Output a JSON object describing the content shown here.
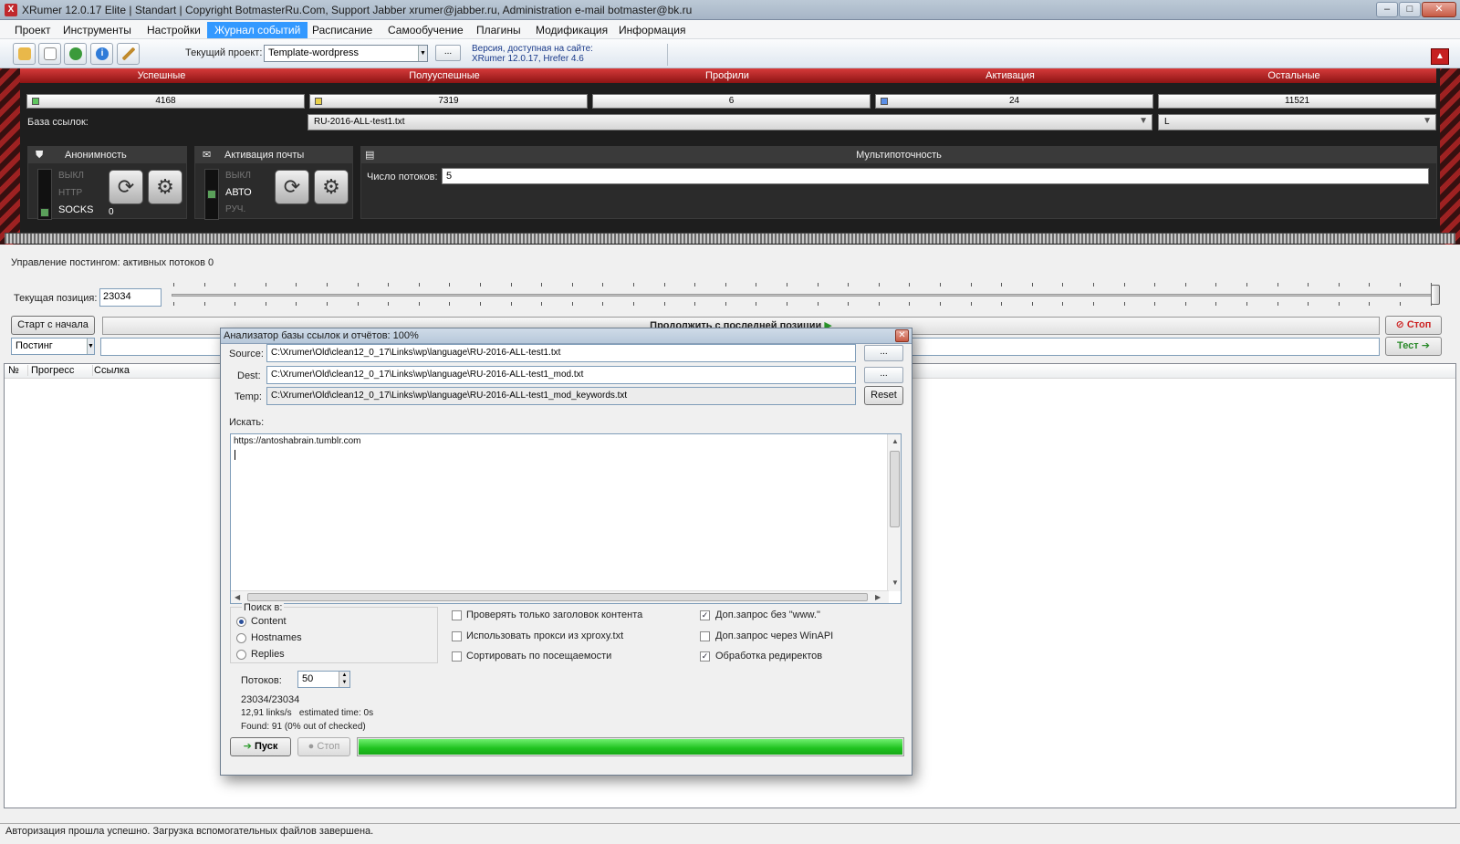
{
  "window": {
    "title": "XRumer 12.0.17 Elite | Standart | Copyright BotmasterRu.Com, Support Jabber xrumer@jabber.ru, Administration e-mail botmaster@bk.ru",
    "minimize": "–",
    "maximize": "□",
    "close": "✕"
  },
  "menu": [
    "Проект",
    "Инструменты",
    "Настройки",
    "Журнал событий",
    "Расписание",
    "Самообучение",
    "Плагины",
    "Модификация",
    "Информация"
  ],
  "menu_active": "Журнал событий",
  "toolbar": {
    "icons": [
      "open-folder-icon",
      "edit-icon",
      "refresh-icon",
      "info-icon",
      "wand-icon"
    ],
    "current_project_label": "Текущий проект:",
    "current_project_value": "Template-wordpress",
    "browse_label": "...",
    "version_line1": "Версия, доступная на сайте:",
    "version_line2": "XRumer 12.0.17, Hrefer 4.6"
  },
  "stats": {
    "headers": [
      "Успешные",
      "Полууспешные",
      "Профили",
      "Активация",
      "Остальные"
    ],
    "values": [
      "4168",
      "7319",
      "6",
      "24",
      "11521"
    ]
  },
  "link_base": {
    "label": "База ссылок:",
    "value": "RU-2016-ALL-test1.txt",
    "secondary_value": "L"
  },
  "anonymity": {
    "title": "Анонимность",
    "options": [
      "ВЫКЛ",
      "HTTP",
      "SOCKS"
    ],
    "selected": "SOCKS",
    "counter": "0"
  },
  "mail_activation": {
    "title": "Активация почты",
    "options": [
      "ВЫКЛ",
      "АВТО",
      "РУЧ."
    ],
    "selected": "АВТО"
  },
  "multithreading": {
    "title": "Мультипоточность",
    "threads_label": "Число потоков:",
    "threads_value": "5"
  },
  "posting": {
    "status": "Управление постингом: активных потоков 0",
    "current_position_label": "Текущая позиция:",
    "current_position_value": "23034",
    "start_button": "Старт с начала",
    "continue_button": "Продолжить с последней позиции",
    "stop_button": "Стоп",
    "test_button": "Тест",
    "mode_value": "Постинг"
  },
  "grid": {
    "columns": [
      "№",
      "Прогресс",
      "Ссылка"
    ]
  },
  "statusbar": "Авторизация прошла успешно. Загрузка вспомогательных файлов завершена.",
  "dialog": {
    "title": "Анализатор базы ссылок и отчётов: 100%",
    "source_label": "Source:",
    "source_value": "C:\\Xrumer\\Old\\clean12_0_17\\Links\\wp\\language\\RU-2016-ALL-test1.txt",
    "dest_label": "Dest:",
    "dest_value": "C:\\Xrumer\\Old\\clean12_0_17\\Links\\wp\\language\\RU-2016-ALL-test1_mod.txt",
    "temp_label": "Temp:",
    "temp_value": "C:\\Xrumer\\Old\\clean12_0_17\\Links\\wp\\language\\RU-2016-ALL-test1_mod_keywords.txt",
    "browse_label": "...",
    "reset_label": "Reset",
    "search_label": "Искать:",
    "search_text": "https://antoshabrain.tumblr.com",
    "search_in_label": "Поиск в:",
    "search_in_options": [
      "Content",
      "Hostnames",
      "Replies"
    ],
    "search_in_selected": "Content",
    "checkboxes": [
      {
        "label": "Проверять только заголовок контента",
        "checked": false
      },
      {
        "label": "Использовать прокси из xproxy.txt",
        "checked": false
      },
      {
        "label": "Сортировать по посещаемости",
        "checked": false
      },
      {
        "label": "Доп.запрос без \"www.\"",
        "checked": true
      },
      {
        "label": "Доп.запрос через WinAPI",
        "checked": false
      },
      {
        "label": "Обработка редиректов",
        "checked": true
      }
    ],
    "threads_label": "Потоков:",
    "threads_value": "50",
    "progress_count": "23034/23034",
    "speed": "12,91 links/s   estimated time: 0s",
    "found": "Found: 91 (0% out of checked)",
    "start_button": "Пуск",
    "stop_button": "Стоп",
    "progress_fraction": 1.0
  },
  "colors": {
    "menu_active": "#3399ff",
    "stat_header": "#b51f1f",
    "progress_fill": "#1fc21f",
    "dark_panel": "#1e1e1e"
  }
}
